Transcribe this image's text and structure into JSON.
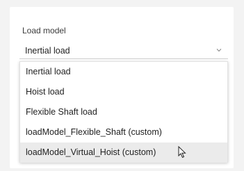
{
  "field": {
    "label": "Load model",
    "selected_value": "Inertial load",
    "expand_icon": "chevron-down-icon"
  },
  "dropdown": {
    "options": [
      {
        "label": "Inertial load"
      },
      {
        "label": "Hoist load"
      },
      {
        "label": "Flexible Shaft load"
      },
      {
        "label": "loadModel_Flexible_Shaft (custom)"
      },
      {
        "label": "loadModel_Virtual_Hoist (custom)",
        "hovered": true
      }
    ]
  },
  "cursor": {
    "icon": "mouse-pointer-icon"
  }
}
